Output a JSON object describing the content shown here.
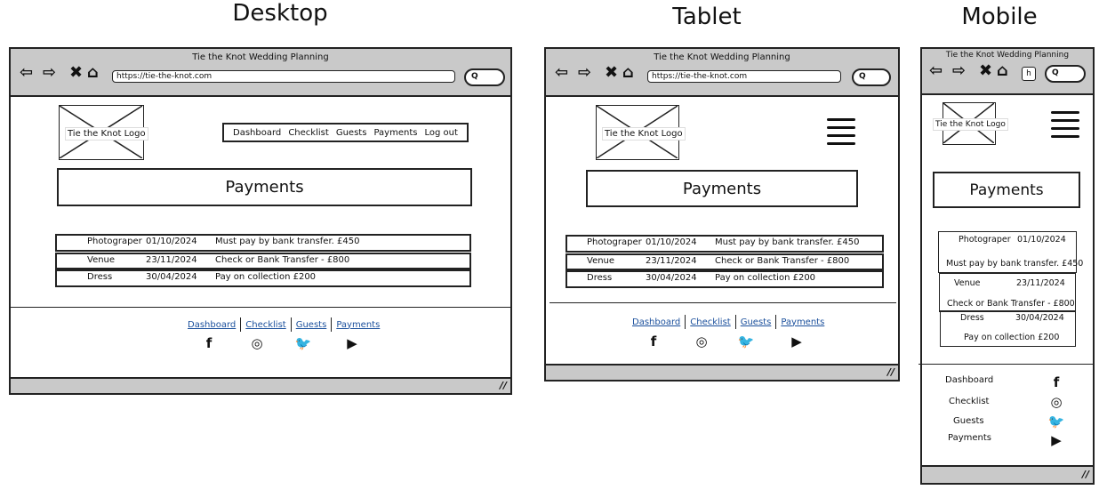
{
  "headings": {
    "desktop": "Desktop",
    "tablet": "Tablet",
    "mobile": "Mobile"
  },
  "browser": {
    "title": "Tie the Knot Wedding Planning",
    "url": "https://tie-the-knot.com",
    "search_glyph": "Q",
    "home_glyph": "h"
  },
  "logo_text": "Tie the Knot Logo",
  "nav": [
    "Dashboard",
    "Checklist",
    "Guests",
    "Payments",
    "Log out"
  ],
  "page_title": "Payments",
  "payments": [
    {
      "item": "Photograper",
      "date": "01/10/2024",
      "note": "Must pay by bank transfer. £450"
    },
    {
      "item": "Venue",
      "date": "23/11/2024",
      "note": "Check or Bank Transfer - £800"
    },
    {
      "item": "Dress",
      "date": "30/04/2024",
      "note": "Pay on collection £200"
    }
  ],
  "footer_links": [
    "Dashboard",
    "Checklist",
    "Guests",
    "Payments"
  ],
  "social_icons": [
    "facebook-icon",
    "instagram-icon",
    "twitter-icon",
    "youtube-icon"
  ],
  "icon_glyphs": {
    "facebook": "f",
    "instagram": "◎",
    "twitter": "🐦",
    "youtube": "▶"
  }
}
